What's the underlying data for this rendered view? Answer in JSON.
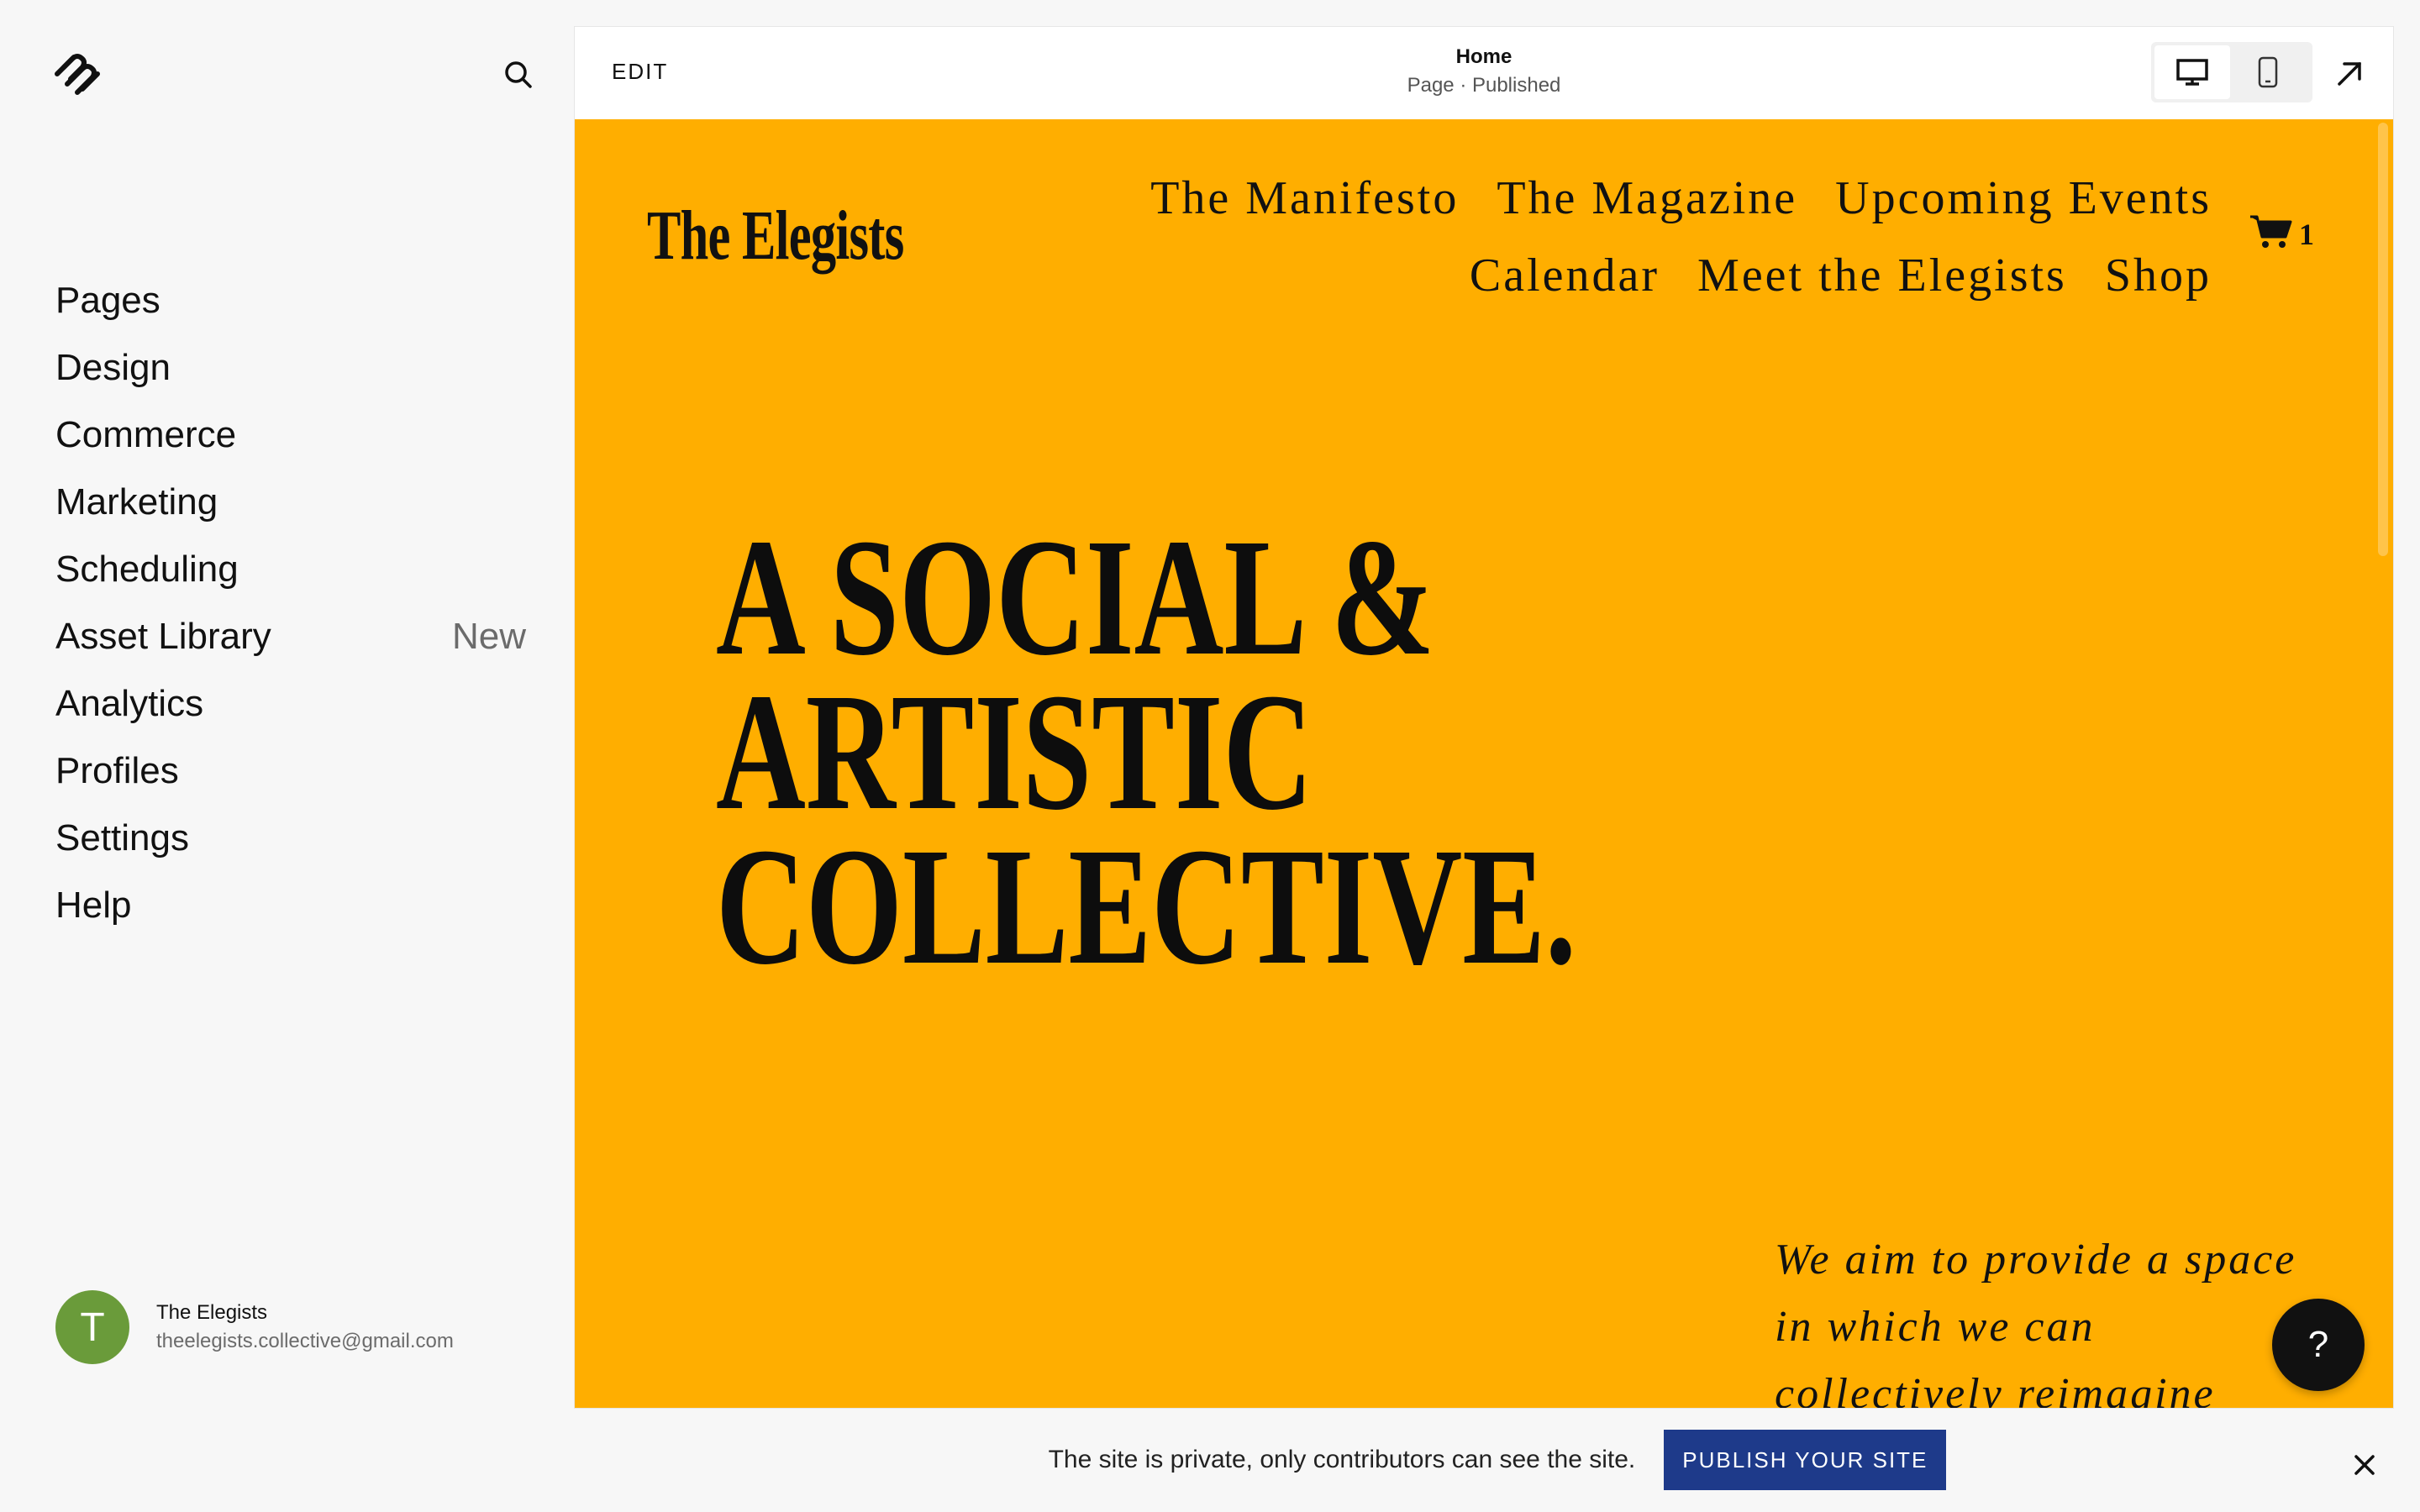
{
  "sidebar": {
    "logo_icon": "squarespace-logo-icon",
    "search_icon": "search-icon",
    "items": [
      {
        "label": "Pages",
        "badge": ""
      },
      {
        "label": "Design",
        "badge": ""
      },
      {
        "label": "Commerce",
        "badge": ""
      },
      {
        "label": "Marketing",
        "badge": ""
      },
      {
        "label": "Scheduling",
        "badge": ""
      },
      {
        "label": "Asset Library",
        "badge": "New"
      },
      {
        "label": "Analytics",
        "badge": ""
      },
      {
        "label": "Profiles",
        "badge": ""
      },
      {
        "label": "Settings",
        "badge": ""
      },
      {
        "label": "Help",
        "badge": ""
      }
    ],
    "account": {
      "initial": "T",
      "name": "The Elegists",
      "email": "theelegists.collective@gmail.com",
      "avatar_color": "#6a9b3a"
    }
  },
  "topbar": {
    "edit_label": "EDIT",
    "page_title": "Home",
    "page_status": "Page · Published"
  },
  "site": {
    "logo": "The Elegists",
    "nav": [
      "The Manifesto",
      "The Magazine",
      "Upcoming Events",
      "Calendar",
      "Meet the Elegists",
      "Shop"
    ],
    "cart_count": "1",
    "hero_lines": [
      "A SOCIAL &",
      "ARTISTIC",
      "COLLECTIVE."
    ],
    "tagline": "We aim to provide a space in which we can collectively reimagine society, re",
    "background_color": "#ffae00"
  },
  "help_label": "?",
  "banner": {
    "text": "The site is private, only contributors can see the site.",
    "publish_label": "PUBLISH YOUR SITE",
    "publish_color": "#1e3a8a"
  }
}
